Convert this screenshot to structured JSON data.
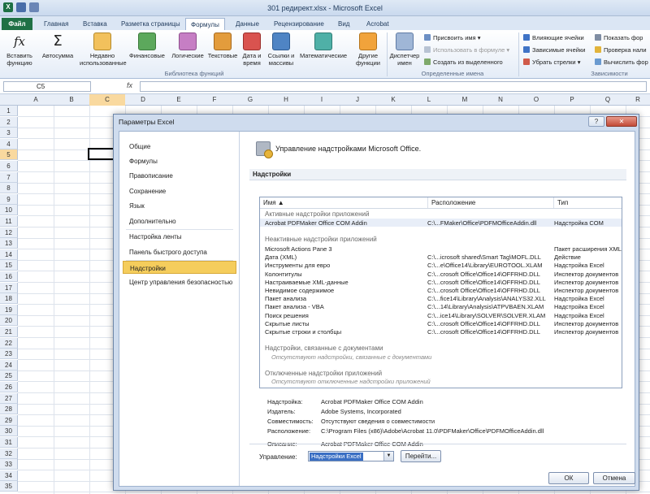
{
  "window": {
    "title": "301 редирект.xlsx - Microsoft Excel",
    "logo": "X"
  },
  "tabs": [
    "Файл",
    "Главная",
    "Вставка",
    "Разметка страницы",
    "Формулы",
    "Данные",
    "Рецензирование",
    "Вид",
    "Acrobat"
  ],
  "ribbon": {
    "insert_function": "Вставить функцию",
    "autosum": "Автосумма",
    "recent": "Недавно использованные",
    "financial": "Финансовые",
    "logical": "Логические",
    "text": "Текстовые",
    "datetime": "Дата и время",
    "lookup": "Ссылки и массивы",
    "math": "Математические",
    "other": "Другие функции",
    "group_library": "Библиотека функций",
    "name_manager": "Диспетчер имен",
    "assign_name": "Присвоить имя",
    "use_in_formula": "Использовать в формуле",
    "create_from_selection": "Создать из выделенного",
    "group_names": "Определенные имена",
    "trace_precedents": "Влияющие ячейки",
    "trace_dependents": "Зависимые ячейки",
    "remove_arrows": "Убрать стрелки",
    "show_formulas": "Показать фор",
    "error_check": "Проверка нали",
    "evaluate": "Вычислить фор",
    "group_audit": "Зависимости"
  },
  "formula_bar": {
    "name_box": "C5",
    "fx": "fx"
  },
  "sheet": {
    "columns": [
      "A",
      "B",
      "C",
      "D",
      "E",
      "F",
      "G",
      "H",
      "I",
      "J",
      "K",
      "L",
      "M",
      "N",
      "O",
      "P",
      "Q",
      "R"
    ],
    "selected_column": "C",
    "rows": [
      "1",
      "2",
      "3",
      "4",
      "5",
      "6",
      "7",
      "8",
      "9",
      "10",
      "11",
      "12",
      "13",
      "14",
      "15",
      "16",
      "17",
      "18",
      "19",
      "20",
      "21",
      "22",
      "23",
      "24",
      "25",
      "26",
      "27",
      "28",
      "29",
      "30",
      "31",
      "32",
      "33",
      "34",
      "35"
    ],
    "selected_row": "5"
  },
  "dialog": {
    "title": "Параметры Excel",
    "help": "?",
    "close": "✕",
    "nav": [
      "Общие",
      "Формулы",
      "Правописание",
      "Сохранение",
      "Язык",
      "Дополнительно",
      "Настройка ленты",
      "Панель быстрого доступа",
      "Надстройки",
      "Центр управления безопасностью"
    ],
    "nav_active": "Надстройки",
    "header": "Управление надстройками Microsoft Office.",
    "section": "Надстройки",
    "columns": {
      "name": "Имя ▲",
      "location": "Расположение",
      "type": "Тип"
    },
    "active_group": "Активные надстройки приложений",
    "active_items": [
      {
        "name": "Acrobat PDFMaker Office COM Addin",
        "location": "C:\\...FMaker\\Office\\PDFMOfficeAddin.dll",
        "type": "Надстройка COM"
      }
    ],
    "inactive_group": "Неактивные надстройки приложений",
    "inactive_items": [
      {
        "name": "Microsoft Actions Pane 3",
        "location": "",
        "type": "Пакет расширения XML"
      },
      {
        "name": "Дата (XML)",
        "location": "C:\\...icrosoft shared\\Smart Tag\\MOFL.DLL",
        "type": "Действие"
      },
      {
        "name": "Инструменты для евро",
        "location": "C:\\...e\\Office14\\Library\\EUROTOOL.XLAM",
        "type": "Надстройка Excel"
      },
      {
        "name": "Колонтитулы",
        "location": "C:\\...crosoft Office\\Office14\\OFFRHD.DLL",
        "type": "Инспектор документов"
      },
      {
        "name": "Настраиваемые XML-данные",
        "location": "C:\\...crosoft Office\\Office14\\OFFRHD.DLL",
        "type": "Инспектор документов"
      },
      {
        "name": "Невидимое содержимое",
        "location": "C:\\...crosoft Office\\Office14\\OFFRHD.DLL",
        "type": "Инспектор документов"
      },
      {
        "name": "Пакет анализа",
        "location": "C:\\...fice14\\Library\\Analysis\\ANALYS32.XLL",
        "type": "Надстройка Excel"
      },
      {
        "name": "Пакет анализа - VBA",
        "location": "C:\\...14\\Library\\Analysis\\ATPVBAEN.XLAM",
        "type": "Надстройка Excel"
      },
      {
        "name": "Поиск решения",
        "location": "C:\\...ice14\\Library\\SOLVER\\SOLVER.XLAM",
        "type": "Надстройка Excel"
      },
      {
        "name": "Скрытые листы",
        "location": "C:\\...crosoft Office\\Office14\\OFFRHD.DLL",
        "type": "Инспектор документов"
      },
      {
        "name": "Скрытые строки и столбцы",
        "location": "C:\\...crosoft Office\\Office14\\OFFRHD.DLL",
        "type": "Инспектор документов"
      }
    ],
    "doc_group": "Надстройки, связанные с документами",
    "doc_empty": "Отсутствуют надстройки, связанные с документами",
    "disabled_group": "Отключенные надстройки приложений",
    "disabled_empty": "Отсутствуют отключенные надстройки приложений",
    "details": [
      {
        "k": "Надстройка:",
        "v": "Acrobat PDFMaker Office COM Addin"
      },
      {
        "k": "Издатель:",
        "v": "Adobe Systems, Incorporated"
      },
      {
        "k": "Совместимость:",
        "v": "Отсутствуют сведения о совместимости"
      },
      {
        "k": "Расположение:",
        "v": "C:\\Program Files (x86)\\Adobe\\Acrobat 11.0\\PDFMaker\\Office\\PDFMOfficeAddin.dll"
      },
      {
        "k": "Описание:",
        "v": "Acrobat PDFMaker Office COM Addin"
      }
    ],
    "manage_label": "Управление:",
    "manage_value": "Надстройки Excel",
    "go": "Перейти...",
    "ok": "ОК",
    "cancel": "Отмена"
  }
}
